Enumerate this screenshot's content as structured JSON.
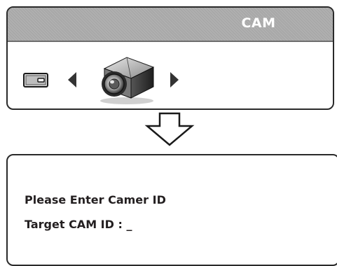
{
  "panel": {
    "title": "CAM"
  },
  "selector": {
    "source_icon": "monitor-icon",
    "left_icon": "arrow-left-icon",
    "center_icon": "camera-icon",
    "right_icon": "arrow-right-icon"
  },
  "transition_icon": "arrow-down-icon",
  "prompt": {
    "line1": "Please Enter Camer ID",
    "line2_label": "Target CAM ID : ",
    "line2_cursor": "_"
  },
  "colors": {
    "header_bg": "#a8a8a8",
    "header_text": "#ffffff",
    "border": "#2a2a2a",
    "text": "#231f20"
  }
}
